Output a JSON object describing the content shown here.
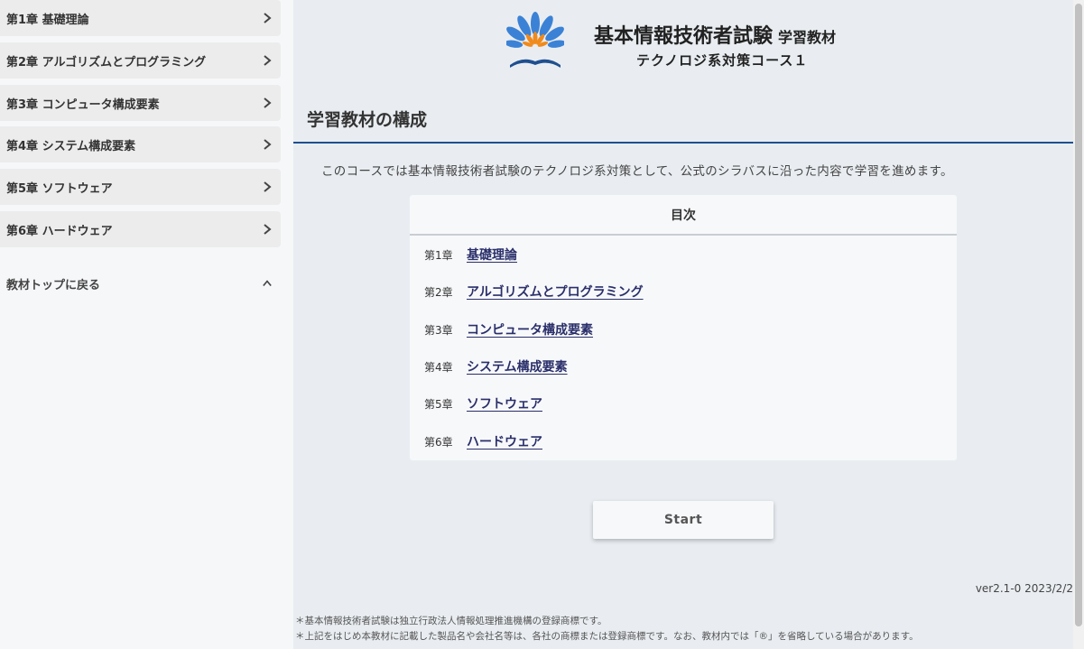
{
  "sidebar": {
    "chapters": [
      {
        "label": "第1章 基礎理論"
      },
      {
        "label": "第2章 アルゴリズムとプログラミング"
      },
      {
        "label": "第3章 コンピュータ構成要素"
      },
      {
        "label": "第4章 システム構成要素"
      },
      {
        "label": "第5章 ソフトウェア"
      },
      {
        "label": "第6章 ハードウェア"
      }
    ],
    "back_to_top": "教材トップに戻る"
  },
  "header": {
    "title": "基本情報技術者試験",
    "title_sub": "学習教材",
    "course": "テクノロジ系対策コース１"
  },
  "section": {
    "title": "学習教材の構成",
    "intro": "このコースでは基本情報技術者試験のテクノロジ系対策として、公式のシラバスに沿った内容で学習を進めます。"
  },
  "toc": {
    "title": "目次",
    "rows": [
      {
        "num": "第1章",
        "label": "基礎理論"
      },
      {
        "num": "第2章",
        "label": "アルゴリズムとプログラミング"
      },
      {
        "num": "第3章",
        "label": "コンピュータ構成要素"
      },
      {
        "num": "第4章",
        "label": "システム構成要素"
      },
      {
        "num": "第5章",
        "label": "ソフトウェア"
      },
      {
        "num": "第6章",
        "label": "ハードウェア"
      }
    ]
  },
  "start_label": "Start",
  "version": "ver2.1-0 2023/2/2",
  "notes": [
    "＊基本情報技術者試験は独立行政法人情報処理推進機構の登録商標です。",
    "＊上記をはじめ本教材に記載した製品名や会社名等は、各社の商標または登録商標です。なお、教材内では「®」を省略している場合があります。"
  ],
  "colors": {
    "accent_rule": "#1f4f8f",
    "link": "#2a2f6a",
    "logo_blue": "#3b82d6",
    "logo_orange": "#f08a1c"
  }
}
